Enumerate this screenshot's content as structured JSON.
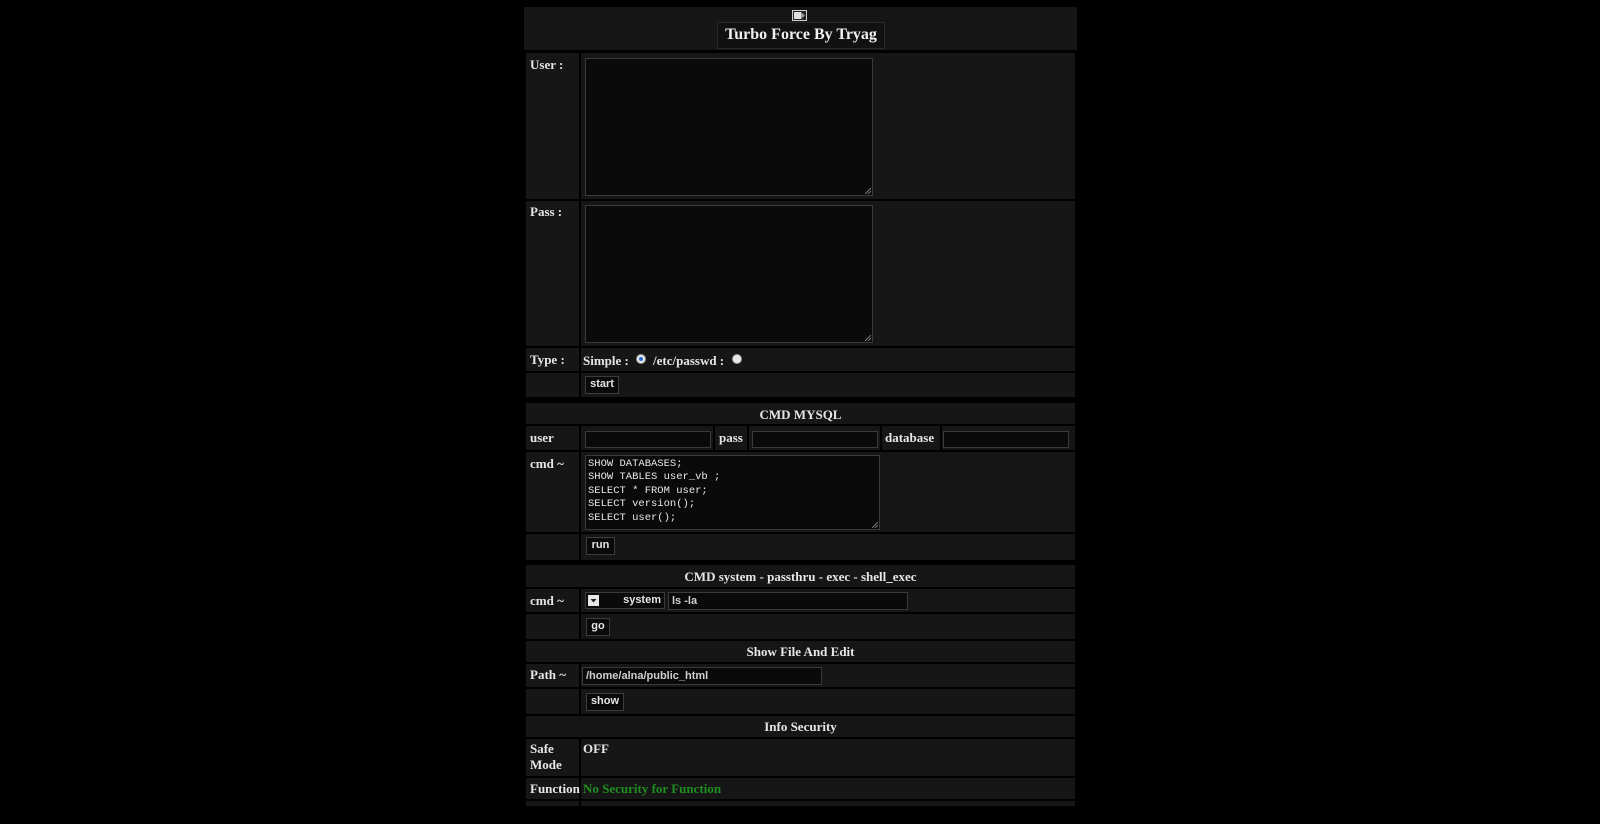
{
  "header": {
    "title": "Turbo Force By Tryag",
    "logo_icon": "broken-image-icon"
  },
  "force": {
    "user_label": "User :",
    "pass_label": "Pass :",
    "type_label": "Type :",
    "simple_label": "Simple :",
    "passwd_label": "/etc/passwd :",
    "selected_type": "Simple",
    "start_label": "start"
  },
  "mysql": {
    "title": "CMD MYSQL",
    "user_label": "user",
    "pass_label": "pass",
    "database_label": "database",
    "cmd_label": "cmd ~",
    "cmd_value": "SHOW DATABASES;\nSHOW TABLES user_vb ;\nSELECT * FROM user;\nSELECT version();\nSELECT user();",
    "run_label": "run"
  },
  "system": {
    "title": "CMD system - passthru - exec - shell_exec",
    "cmd_label": "cmd ~",
    "function_selected": "system",
    "cmd_value": "ls -la",
    "go_label": "go"
  },
  "file": {
    "title": "Show File And Edit",
    "path_label": "Path ~",
    "path_value": "/home/alna/public_html",
    "show_label": "show"
  },
  "security": {
    "title": "Info Security",
    "safe_mode_label_1": "Safe",
    "safe_mode_label_2": "Mode",
    "safe_mode_value": "OFF",
    "function_label": "Function",
    "function_value": "No Security for Function",
    "function_value_color": "#1f8f1f"
  }
}
